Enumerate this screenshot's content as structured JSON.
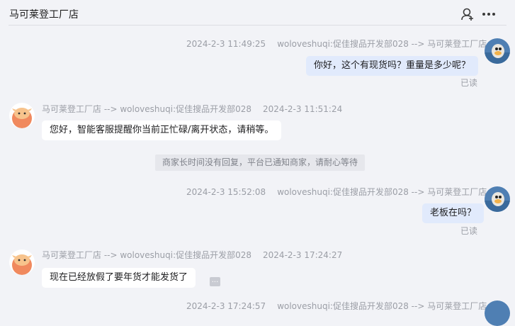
{
  "header": {
    "title": "马可莱登工厂店",
    "icons": [
      "user-icon",
      "more-icon"
    ]
  },
  "messages": [
    {
      "direction": "out",
      "time": "2024-2-3 11:49:25",
      "route": "woloveshuqi:促佳搜品开发部028 --> 马可莱登工厂店",
      "text": "你好，这个有现货吗？重量是多少呢？",
      "status": "已读"
    },
    {
      "direction": "in",
      "route": "马可莱登工厂店 --> woloveshuqi:促佳搜品开发部028",
      "time": "2024-2-3 11:51:24",
      "text": "您好，智能客服提醒你当前正忙碌/离开状态，请稍等。"
    },
    {
      "direction": "out",
      "time": "2024-2-3 15:52:08",
      "route": "woloveshuqi:促佳搜品开发部028 --> 马可莱登工厂店",
      "text": "老板在吗？",
      "status": "已读"
    },
    {
      "direction": "in",
      "route": "马可莱登工厂店 --> woloveshuqi:促佳搜品开发部028",
      "time": "2024-2-3 17:24:27",
      "text": "现在已经放假了要年货才能发货了"
    },
    {
      "direction": "out",
      "time": "2024-2-3 17:24:57",
      "route": "woloveshuqi:促佳搜品开发部028 --> 马可莱登工厂店"
    }
  ],
  "system_notice": "商家长时间没有回复，平台已通知商家，请耐心等待",
  "colors": {
    "background": "#f2f3f7",
    "bubble_out": "#e1eafc",
    "bubble_in": "#ffffff",
    "meta_text": "#9b9ea6"
  }
}
